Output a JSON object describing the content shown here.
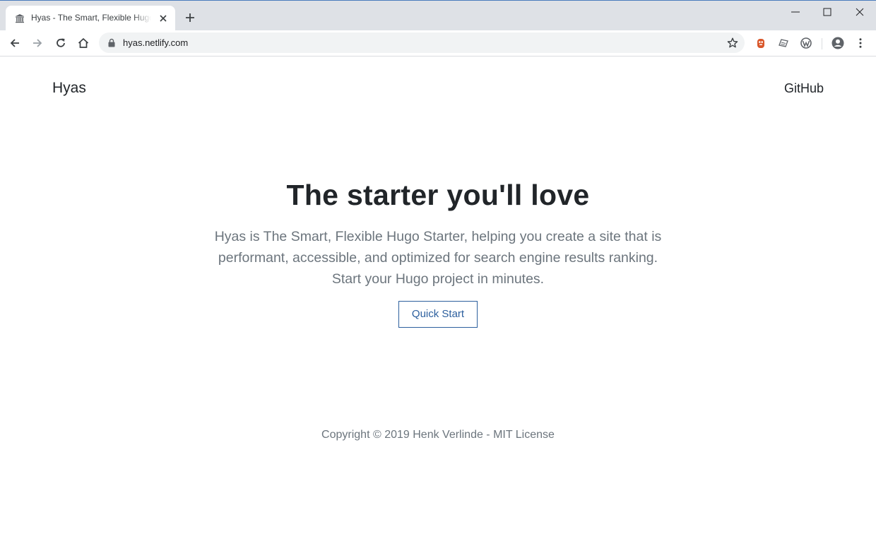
{
  "browser": {
    "tab_title": "Hyas - The Smart, Flexible Hugo Starter",
    "url": "hyas.netlify.com",
    "icons": {
      "favicon": "bank-building-icon",
      "close": "close-icon",
      "new_tab": "plus-icon",
      "back": "arrow-left-icon",
      "forward": "arrow-right-icon",
      "reload": "reload-icon",
      "home": "home-icon",
      "lock": "lock-icon",
      "bookmark": "star-icon",
      "profile": "account-circle-icon",
      "menu": "more-vert-icon"
    },
    "accent": "#4a7bbd"
  },
  "site": {
    "brand": "Hyas",
    "nav_github": "GitHub",
    "hero_title": "The starter you'll love",
    "hero_lead": "Hyas is The Smart, Flexible Hugo Starter, helping you create a site that is performant, accessible, and optimized for search engine results ranking. Start your Hugo project in minutes.",
    "cta_label": "Quick Start",
    "footer_text": "Copyright © 2019 Henk Verlinde - MIT License",
    "link_color": "#2c5f9e"
  }
}
